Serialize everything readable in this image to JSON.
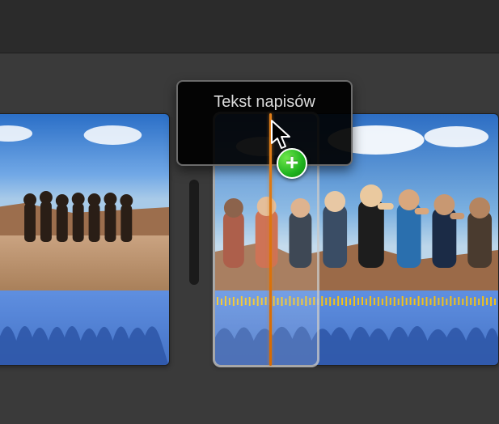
{
  "title_overlay": {
    "label": "Tekst napisów"
  },
  "cursor": {
    "badge_glyph": "+"
  }
}
